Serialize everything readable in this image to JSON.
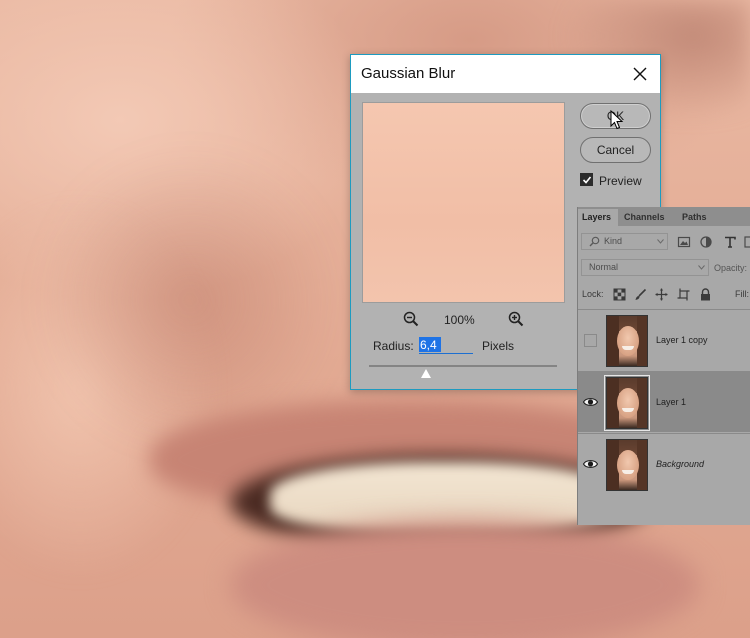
{
  "dialog": {
    "title": "Gaussian Blur",
    "ok_label": "OK",
    "cancel_label": "Cancel",
    "preview_label": "Preview",
    "preview_checked": true,
    "zoom_level": "100%",
    "radius_label": "Radius:",
    "radius_value": "6,4",
    "radius_units": "Pixels"
  },
  "layers_panel": {
    "tabs": [
      "Layers",
      "Channels",
      "Paths"
    ],
    "active_tab": "Layers",
    "filter": {
      "kind_label": "Kind"
    },
    "blend_mode": "Normal",
    "opacity_label": "Opacity:",
    "lock_label": "Lock:",
    "fill_label": "Fill:",
    "layers": [
      {
        "name": "Layer 1 copy",
        "visible": false,
        "selected": false
      },
      {
        "name": "Layer 1",
        "visible": true,
        "selected": true
      },
      {
        "name": "Background",
        "visible": true,
        "selected": false
      }
    ]
  },
  "colors": {
    "dialog_border": "#1d9bc0",
    "selection_highlight": "#1e73e6",
    "panel_bg": "#a8a8a8"
  }
}
